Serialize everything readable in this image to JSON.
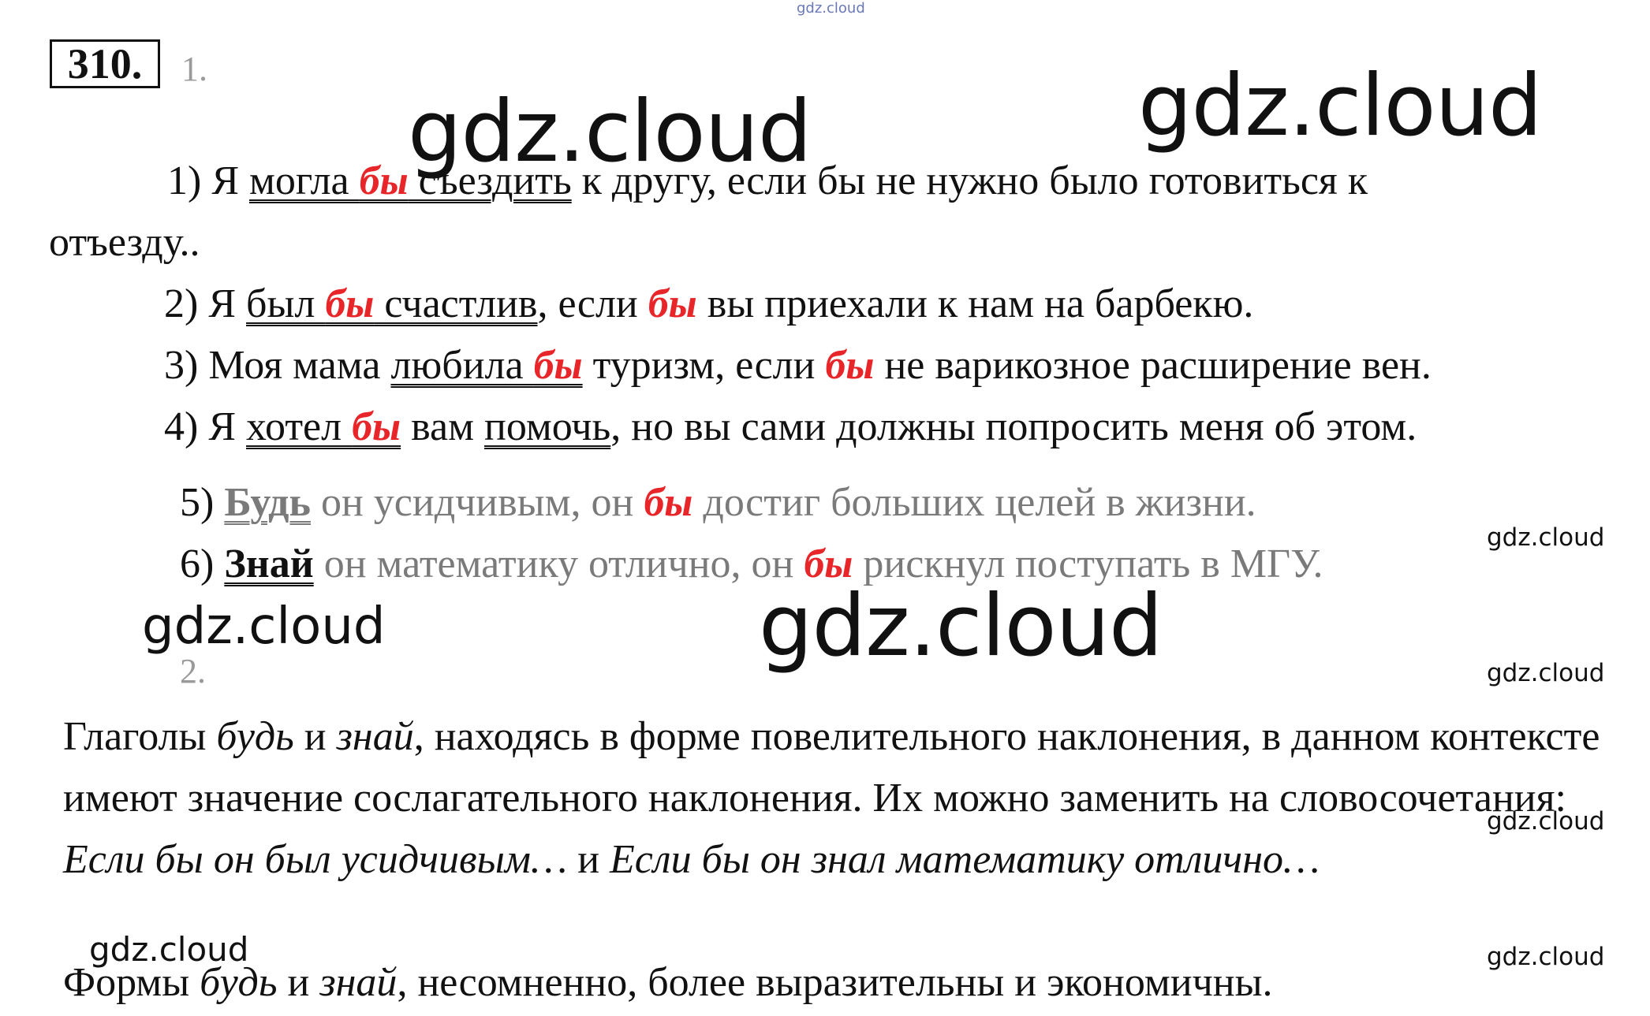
{
  "watermark": "gdz.cloud",
  "task_number": "310.",
  "part1_label": "1.",
  "part2_label": "2.",
  "s1": {
    "num": "1) Я ",
    "w1": "могла ",
    "red1": "бы",
    "w2": " съездить",
    "rest": " к другу, если бы не нужно было готовиться к",
    "cont": "отъезду.."
  },
  "s2": {
    "num": "2) Я ",
    "w1": "был ",
    "red1": "бы",
    "w2": " счастлив",
    "mid": ", если ",
    "red2": "бы",
    "rest": " вы приехали к нам на барбекю."
  },
  "s3": {
    "num": "3) Моя мама ",
    "w1": "любила ",
    "red1": "бы",
    "mid": " туризм, если ",
    "red2": "бы",
    "rest": " не варикозное расширение вен."
  },
  "s4": {
    "num": "4) Я ",
    "w1": "хотел ",
    "red1": "бы",
    "mid": " вам ",
    "w2": "помочь",
    "rest": ", но вы сами должны попросить меня об этом."
  },
  "s5": {
    "num": "5) ",
    "w1": "Будь",
    "mid": " он усидчивым, он ",
    "red1": "бы",
    "rest": " достиг больших целей в жизни."
  },
  "s6": {
    "num": "6) ",
    "w1": "Знай",
    "mid": " он математику отлично, он ",
    "red1": "бы",
    "rest": " рискнул поступать в МГУ."
  },
  "p1": {
    "a": "Глаголы ",
    "b": "будь",
    "c": " и ",
    "d": "знай",
    "e": ", находясь в форме повелительного наклонения, в данном контексте имеют значение сослагательного наклонения. Их можно заменить на словосочетания: ",
    "f": "Если бы он был усидчивым…",
    "g": " и ",
    "h": "Если бы он знал математику отлично…"
  },
  "p2": {
    "a": "Формы ",
    "b": "будь",
    "c": " и ",
    "d": "знай",
    "e": ", несомненно, более выразительны и экономичны."
  }
}
